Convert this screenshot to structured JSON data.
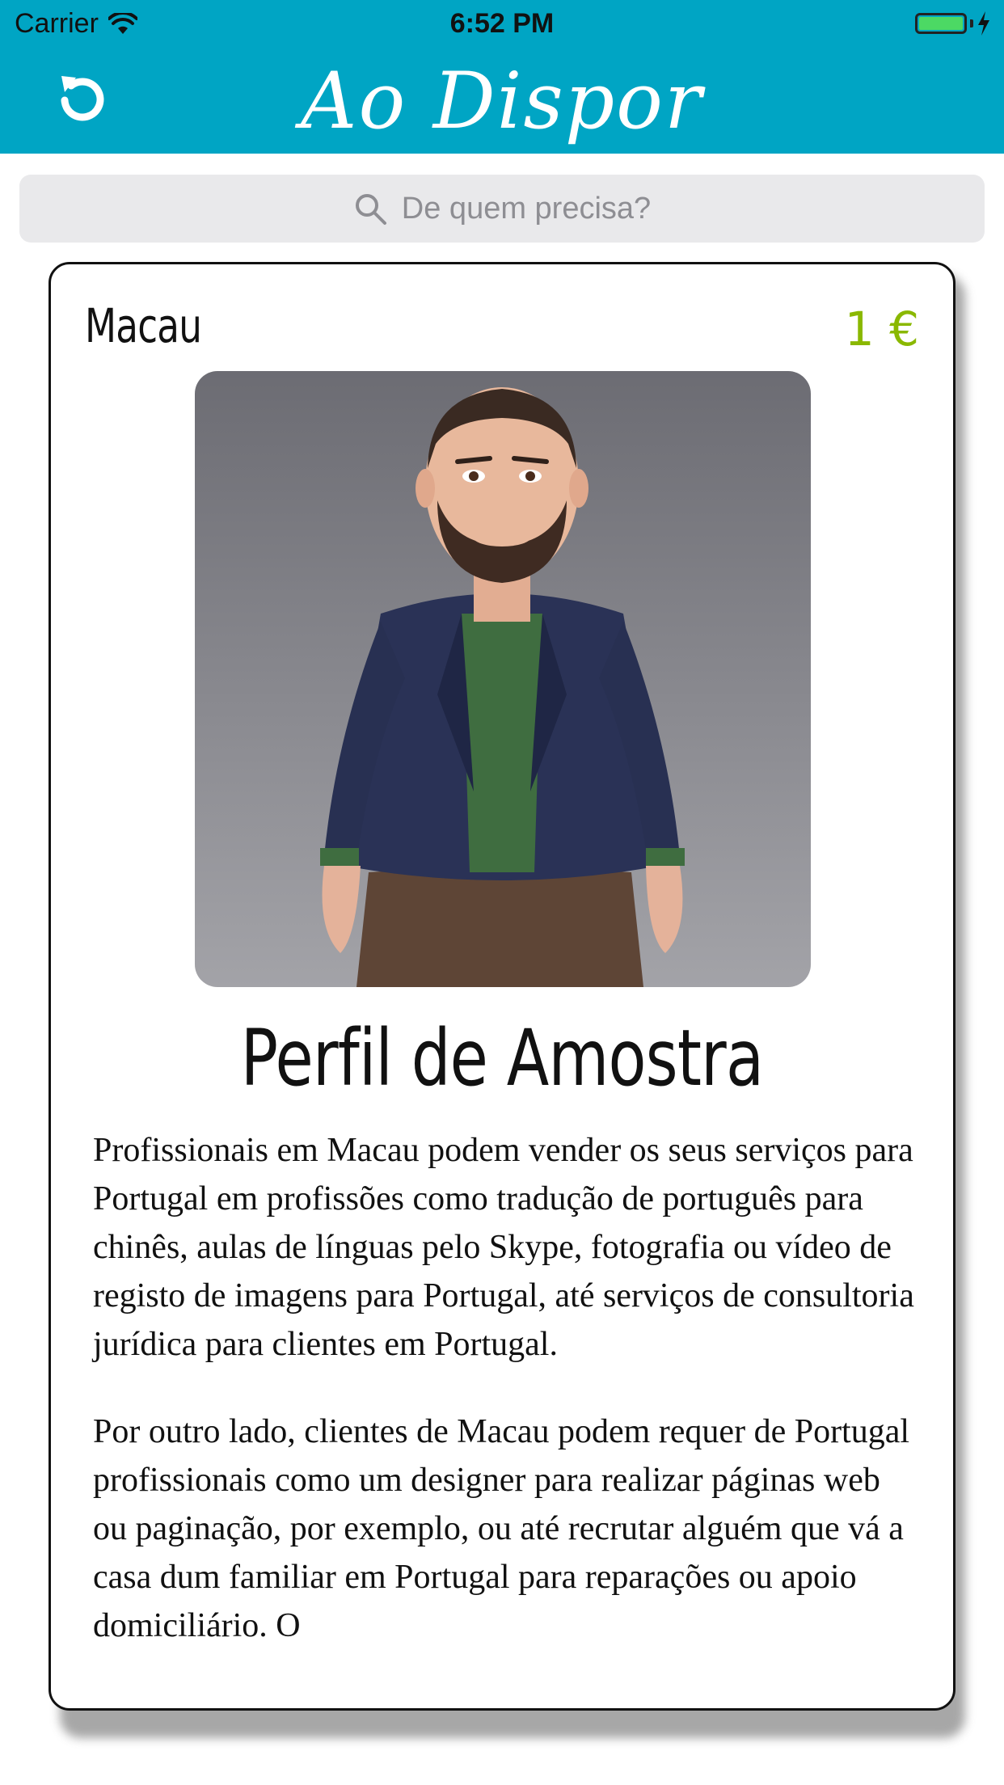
{
  "status_bar": {
    "carrier": "Carrier",
    "time": "6:52 PM"
  },
  "header": {
    "title": "Ao Dispor",
    "refresh_icon": "refresh-icon",
    "brand_color": "#00a5c4"
  },
  "search": {
    "placeholder": "De quem precisa?",
    "icon": "search-icon"
  },
  "card": {
    "location": "Macau",
    "price": "1 €",
    "price_color": "#8ab800",
    "avatar_icon": "avatar-image",
    "name": "Perfil de Amostra",
    "paragraphs": [
      "Profissionais em Macau podem vender os seus serviços para Portugal em profissões como tradução de português para chinês, aulas de línguas pelo Skype, fotografia ou vídeo de registo de imagens para Portugal, até serviços de consultoria jurídica para clientes em Portugal.",
      "Por outro lado, clientes de Macau podem requer de Portugal profissionais como um designer para realizar páginas web ou paginação, por exemplo, ou até recrutar alguém que vá a casa dum familiar em Portugal para reparações ou apoio domiciliário. O"
    ]
  }
}
